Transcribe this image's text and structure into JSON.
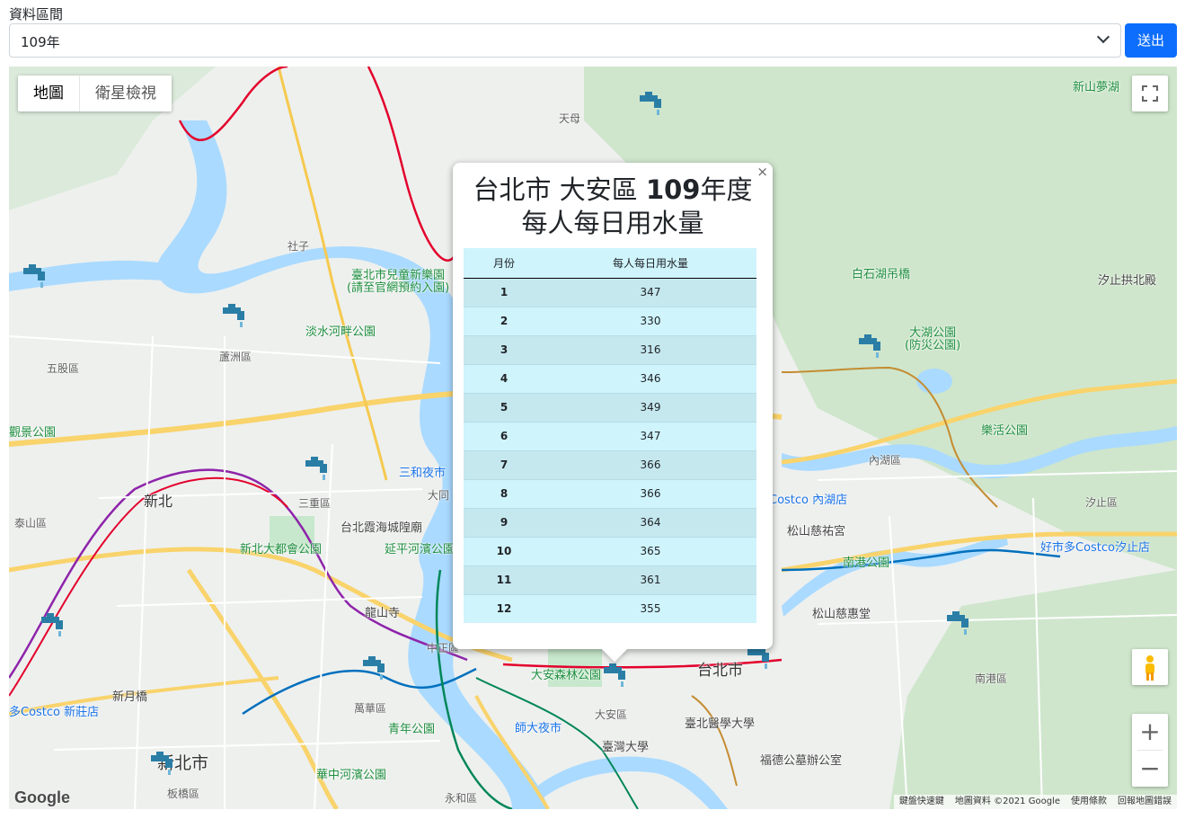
{
  "form": {
    "label": "資料區間",
    "selected": "109年",
    "submit": "送出"
  },
  "map": {
    "type_map": "地圖",
    "type_satellite": "衛星檢視",
    "zoom_in": "+",
    "zoom_out": "−",
    "labels": {
      "taipei": "台北市",
      "new_taipei": "新北市",
      "xinbei": "新北",
      "sanchong": "三重區",
      "luzhou": "蘆洲區",
      "wugu": "五股區",
      "taishan": "泰山區",
      "daan": "大安區",
      "wanhua": "萬華區",
      "zhongzheng": "中正區",
      "neihu": "內湖區",
      "nangang": "南港區",
      "xizhi": "汐止區",
      "banqiao": "板橋區",
      "yonghe": "永和區",
      "children_park": "臺北市兒童新樂園\n(請至官網預約入園)",
      "danshui_park": "淡水河畔公園",
      "dahu_park": "大湖公園\n(防災公園)",
      "baishihu": "白石湖吊橋",
      "xinshan": "新山夢湖",
      "xizhi_temple": "汐止拱北殿",
      "lehuo_park": "樂活公園",
      "nangang_park": "南港公園",
      "costco_xizhi": "好市多Costco汐止店",
      "costco_neihu": "Costco 內湖店",
      "sanhe_market": "三和夜市",
      "dadu_park": "新北大都會公園",
      "yanping_park": "延平河濱公園",
      "xiahai": "台北霞海城隍廟",
      "longshan": "龍山寺",
      "daan_park": "大安森林公園",
      "shida": "師大夜市",
      "ntu": "臺灣大學",
      "tmu": "臺北醫學大學",
      "songshan_ciyou": "松山慈祐宮",
      "songshan_cihui": "松山慈惠堂",
      "youth_park": "青年公園",
      "huazhong": "華中河濱公園",
      "costco_xinzhuang": "多Costco 新莊店",
      "xinyueqiao": "新月橋",
      "guanyin": "觀景公園",
      "tianmu": "天母",
      "dadaocheng": "大同",
      "shezi": "社子",
      "fuzhou": "福德公墓辦公室"
    },
    "attribution": [
      "鍵盤快速鍵",
      "地圖資料 ©2021 Google",
      "使用條款",
      "回報地圖錯誤"
    ],
    "logo": "Google"
  },
  "popup": {
    "close": "×",
    "title_prefix": "台北市 大安區 ",
    "title_year": "109",
    "title_suffix": "年度",
    "title_line2": "每人每日用水量",
    "columns": [
      "月份",
      "每人每日用水量"
    ],
    "rows": [
      {
        "month": "1",
        "value": "347"
      },
      {
        "month": "2",
        "value": "330"
      },
      {
        "month": "3",
        "value": "316"
      },
      {
        "month": "4",
        "value": "346"
      },
      {
        "month": "5",
        "value": "349"
      },
      {
        "month": "6",
        "value": "347"
      },
      {
        "month": "7",
        "value": "366"
      },
      {
        "month": "8",
        "value": "366"
      },
      {
        "month": "9",
        "value": "364"
      },
      {
        "month": "10",
        "value": "365"
      },
      {
        "month": "11",
        "value": "361"
      },
      {
        "month": "12",
        "value": "355"
      }
    ]
  },
  "colors": {
    "primary": "#0d6efd",
    "table_header": "#cff4fc",
    "river": "#aadaff",
    "park": "#c7e8cc",
    "tap_marker": "#2a7ea6"
  }
}
